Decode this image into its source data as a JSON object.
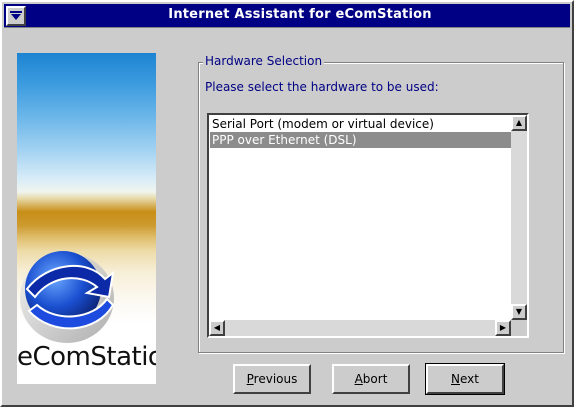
{
  "window": {
    "title": "Internet Assistant for eComStation"
  },
  "logo": {
    "brand_text": "eComStation"
  },
  "hardware": {
    "group_label": "Hardware Selection",
    "prompt": "Please select the hardware to be used:",
    "items": [
      {
        "label": "Serial Port (modem or virtual device)",
        "selected": false
      },
      {
        "label": "PPP over Ethernet (DSL)",
        "selected": true
      }
    ]
  },
  "buttons": {
    "previous": {
      "mnemonic": "P",
      "rest": "revious"
    },
    "abort": {
      "mnemonic": "A",
      "rest": "bort"
    },
    "next": {
      "mnemonic": "N",
      "rest": "ext"
    }
  },
  "icons": {
    "system_menu": "system-menu-icon",
    "scroll_up": "arrow-up-icon",
    "scroll_down": "arrow-down-icon",
    "scroll_left": "arrow-left-icon",
    "scroll_right": "arrow-right-icon",
    "logo_globe": "globe-logo-icon"
  },
  "colors": {
    "title_bar": "#000084",
    "label_text": "#000084",
    "window_bg": "#cccccc",
    "selection": "#8c8c8c"
  }
}
